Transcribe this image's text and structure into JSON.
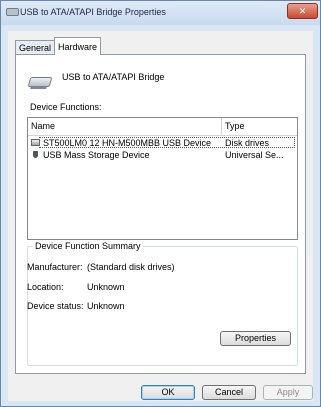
{
  "window": {
    "title": "USB to ATA/ATAPI Bridge Properties",
    "close_label": "✕"
  },
  "tabs": [
    {
      "label": "General",
      "active": false
    },
    {
      "label": "Hardware",
      "active": true
    }
  ],
  "device": {
    "name": "USB to ATA/ATAPI Bridge",
    "icon": "drive-icon"
  },
  "functions": {
    "label": "Device Functions:",
    "columns": [
      "Name",
      "Type"
    ],
    "rows": [
      {
        "name": "ST500LM0 12 HN-M500MBB USB Device",
        "type": "Disk drives",
        "icon": "disk-drive-icon",
        "selected": true
      },
      {
        "name": "USB Mass Storage Device",
        "type": "Universal Se...",
        "icon": "usb-icon",
        "selected": false
      }
    ]
  },
  "summary": {
    "title": "Device Function Summary",
    "manufacturer_label": "Manufacturer:",
    "manufacturer_value": "(Standard disk drives)",
    "location_label": "Location:",
    "location_value": "Unknown",
    "status_label": "Device status:",
    "status_value": "Unknown",
    "properties_button": "Properties"
  },
  "buttons": {
    "ok": "OK",
    "cancel": "Cancel",
    "apply": "Apply"
  }
}
